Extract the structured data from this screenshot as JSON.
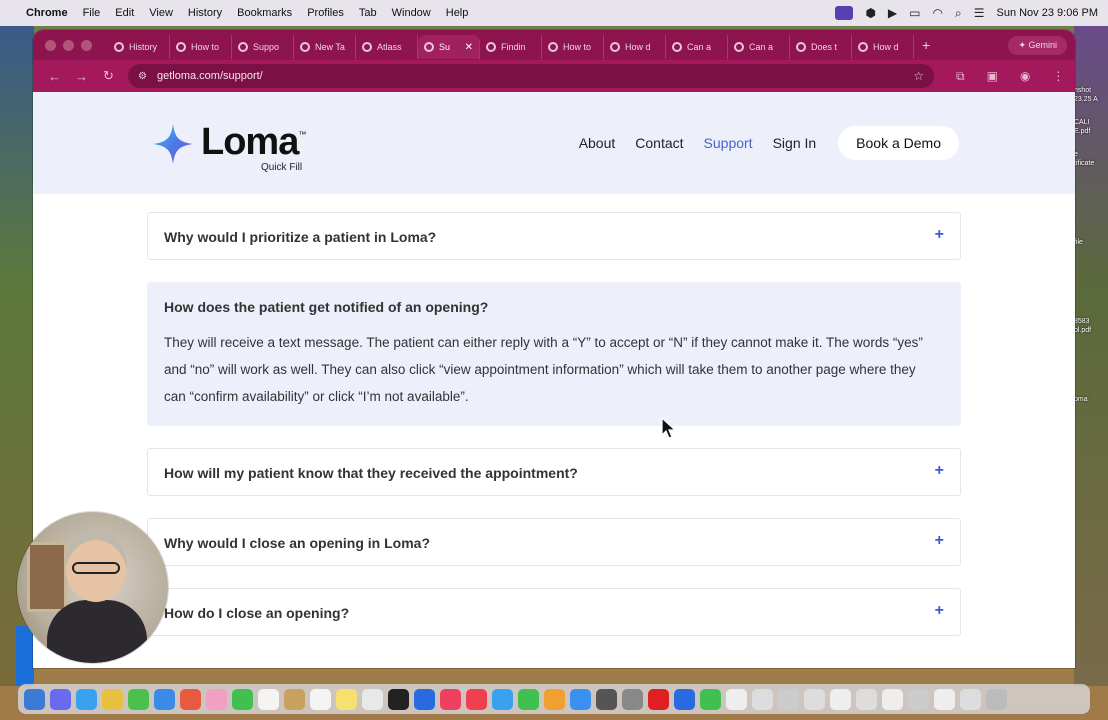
{
  "menubar": {
    "app": "Chrome",
    "items": [
      "File",
      "Edit",
      "View",
      "History",
      "Bookmarks",
      "Profiles",
      "Tab",
      "Window",
      "Help"
    ],
    "clock": "Sun Nov 23  9:06 PM"
  },
  "browser": {
    "tabs": [
      {
        "label": "History"
      },
      {
        "label": "How to"
      },
      {
        "label": "Suppo"
      },
      {
        "label": "New Ta"
      },
      {
        "label": "Atlass"
      },
      {
        "label": "Su",
        "active": true
      },
      {
        "label": "Findin"
      },
      {
        "label": "How to"
      },
      {
        "label": "How d"
      },
      {
        "label": "Can a"
      },
      {
        "label": "Can a"
      },
      {
        "label": "Does t"
      },
      {
        "label": "How d"
      }
    ],
    "gemini_label": "Gemini",
    "url": "getloma.com/support/"
  },
  "site": {
    "logo_word": "Loma",
    "logo_tm": "™",
    "logo_sub": "Quick Fill",
    "nav": {
      "about": "About",
      "contact": "Contact",
      "support": "Support",
      "signin": "Sign In",
      "demo": "Book a Demo"
    }
  },
  "faq": {
    "items": [
      {
        "question": "Why would I prioritize a patient in Loma?"
      },
      {
        "question": "How does the patient get notified of an opening?",
        "answer": "They will receive a text message. The patient can either reply with a “Y” to accept or “N” if they cannot make it. The words “yes” and “no” will work as well. They can also click “view appointment information” which will take them to another page where they can “confirm availability” or click “I’m not available”."
      },
      {
        "question": "How will my patient know that they received the appointment?"
      },
      {
        "question": "Why would I close an opening in Loma?"
      },
      {
        "question": "How do I close an opening?"
      }
    ],
    "plus_symbol": "+"
  },
  "desktop_right_labels": [
    "nshot",
    "23.25 A",
    "CALI",
    "E.pdf",
    "e",
    "tificate",
    "file",
    "8583",
    "ol.pdf",
    "oma"
  ],
  "colors": {
    "tab_bar": "#8e1450",
    "toolbar": "#a3195c",
    "accent": "#3d5bd1",
    "nav_active": "#4a63c9",
    "header_bg": "#edf0fb"
  }
}
